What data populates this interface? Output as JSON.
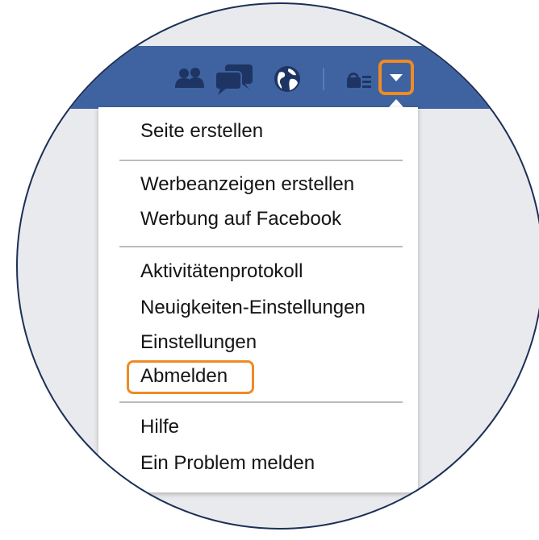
{
  "header": {
    "icons": [
      "friends-icon",
      "messages-icon",
      "globe-icon",
      "privacy-icon",
      "menu-arrow-icon"
    ]
  },
  "menu": {
    "groups": [
      {
        "items": [
          "Seite erstellen"
        ]
      },
      {
        "items": [
          "Werbeanzeigen erstellen",
          "Werbung auf Facebook"
        ]
      },
      {
        "items": [
          "Aktivitätenprotokoll",
          "Neuigkeiten-Einstellungen",
          "Einstellungen",
          "Abmelden"
        ]
      },
      {
        "items": [
          "Hilfe",
          "Ein Problem melden"
        ]
      }
    ]
  },
  "colors": {
    "facebook_blue": "#3e63a0",
    "highlight_orange": "#f08a24",
    "background_grey": "#e9eaed",
    "circle_border": "#1c2f57"
  }
}
